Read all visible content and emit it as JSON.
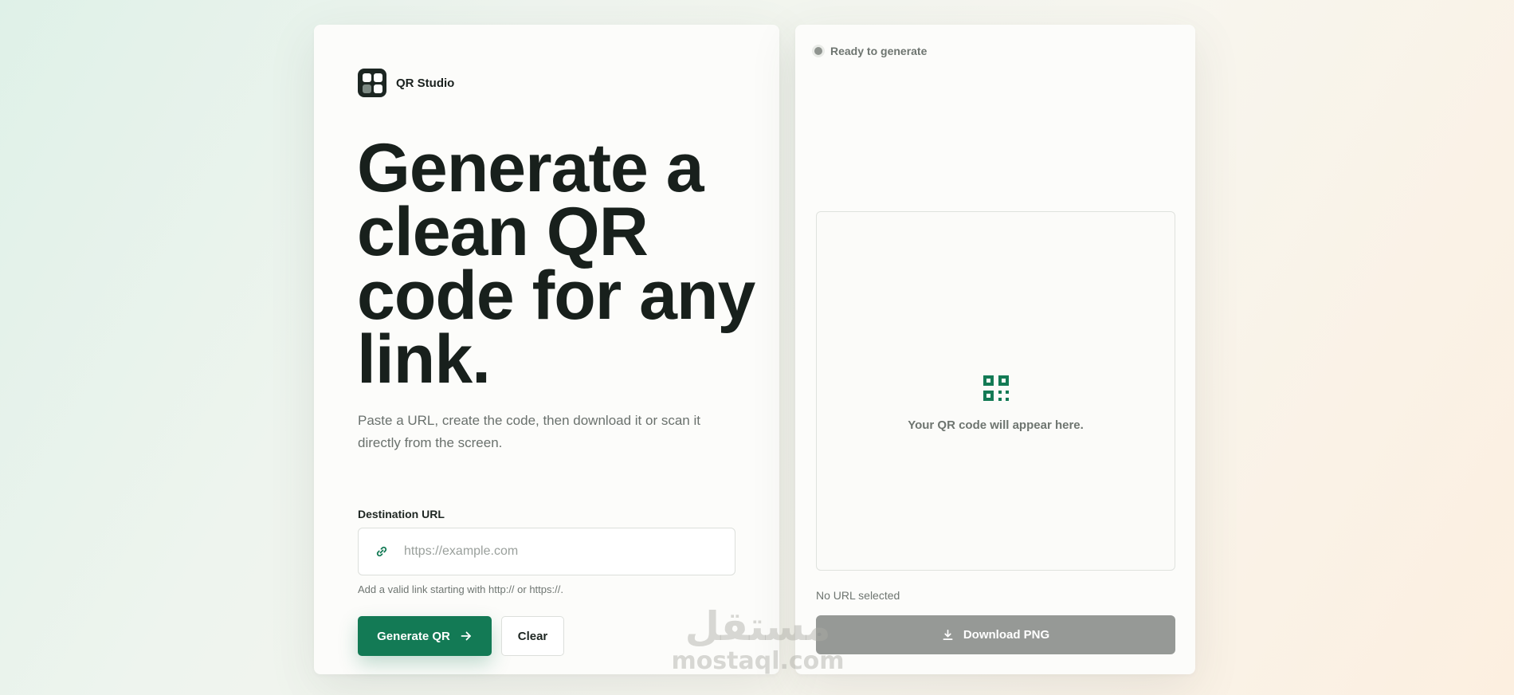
{
  "brand": {
    "name": "QR Studio",
    "logo_icon": "qr-grid-logo-icon"
  },
  "hero": {
    "headline": "Generate a clean QR code for any link.",
    "lead": "Paste a URL, create the code, then download it or scan it directly from the screen."
  },
  "form": {
    "label": "Destination URL",
    "url_value": "",
    "url_placeholder": "https://example.com",
    "hint": "Add a valid link starting with http:// or https://.",
    "generate_label": "Generate QR",
    "clear_label": "Clear"
  },
  "preview": {
    "status": "Ready to generate",
    "placeholder_text": "Your QR code will appear here.",
    "selected_text": "No URL selected",
    "download_label": "Download PNG"
  },
  "watermark": {
    "arabic": "مستقل",
    "latin": "mostaql.com"
  },
  "colors": {
    "accent": "#137a55",
    "ink": "#18201c",
    "muted": "#6e7570",
    "disabled": "#969996",
    "logo_bg": "#1c2622"
  }
}
